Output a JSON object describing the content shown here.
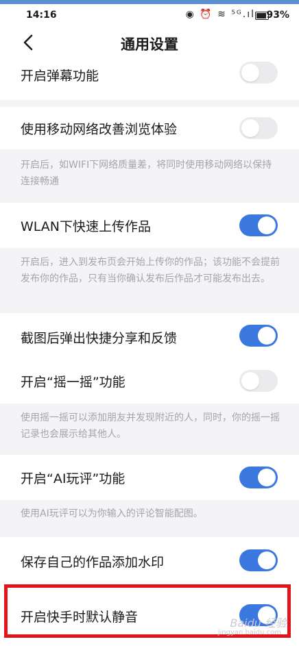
{
  "status_bar": {
    "time": "14:16",
    "icons": "◉ ⏰ ≋ ⁵ᴳ.ıl",
    "battery": "93%"
  },
  "header": {
    "title": "通用设置"
  },
  "settings": [
    {
      "label": "开启弹幕功能",
      "on": false
    },
    {
      "label": "使用移动网络改善浏览体验",
      "on": false,
      "desc": "开启后，如WIFI下网络质量差，将同时使用移动网络以保持连接畅通"
    },
    {
      "label": "WLAN下快速上传作品",
      "on": true,
      "desc": "开启后，进入到发布页会开始上传你的作品；该功能不会提前发布你的作品，只有当你确认发布后作品才可能发布出去。"
    },
    {
      "label": "截图后弹出快捷分享和反馈",
      "on": true
    },
    {
      "label": "开启“摇一摇”功能",
      "on": false,
      "desc": "使用摇一摇可以添加朋友并发现附近的人，同时，你的摇一摇记录也会展示给其他人。"
    },
    {
      "label": "开启“AI玩评”功能",
      "on": true,
      "desc": "使用AI玩评可以为你输入的评论智能配图。"
    },
    {
      "label": "保存自己的作品添加水印",
      "on": true
    },
    {
      "label": "开启快手时默认静音",
      "on": true
    }
  ],
  "watermark": {
    "text": "Baidu 经验",
    "sub": "jingyan.baidu.com"
  },
  "colors": {
    "toggle_on": "#3a78e0",
    "toggle_off": "#ebebee",
    "highlight": "#e2141b"
  }
}
